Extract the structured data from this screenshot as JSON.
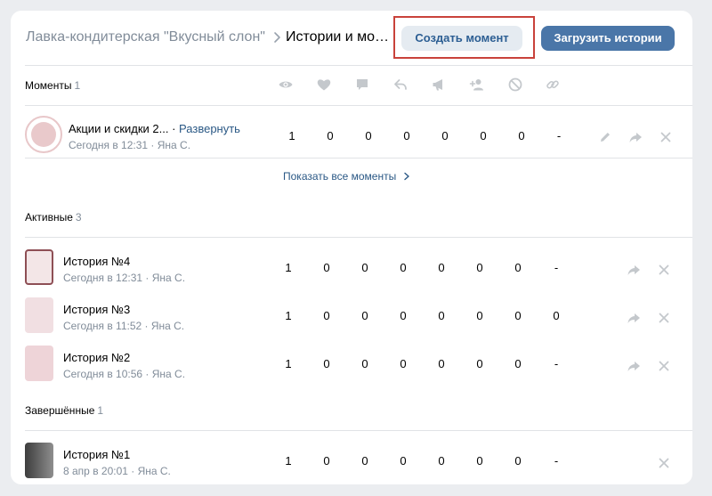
{
  "header": {
    "breadcrumb_parent": "Лавка-кондитерская \"Вкусный слон\"",
    "breadcrumb_current": "Истории и моменты",
    "create_moment_label": "Создать момент",
    "upload_stories_label": "Загрузить истории"
  },
  "columns": [
    "eye-icon",
    "heart-icon",
    "comment-icon",
    "reply-icon",
    "megaphone-icon",
    "add-user-icon",
    "block-icon",
    "link-icon"
  ],
  "moments": {
    "title": "Моменты",
    "count": "1",
    "items": [
      {
        "title": "Акции и скидки 2...",
        "expand": "Развернуть",
        "subtitle": "Сегодня в 12:31 · Яна С.",
        "values": [
          "1",
          "0",
          "0",
          "0",
          "0",
          "0",
          "0",
          "-"
        ]
      }
    ],
    "show_all": "Показать все моменты"
  },
  "active": {
    "title": "Активные",
    "count": "3",
    "items": [
      {
        "title": "История №4",
        "subtitle": "Сегодня в 12:31 · Яна С.",
        "values": [
          "1",
          "0",
          "0",
          "0",
          "0",
          "0",
          "0",
          "-"
        ]
      },
      {
        "title": "История №3",
        "subtitle": "Сегодня в 11:52 · Яна С.",
        "values": [
          "1",
          "0",
          "0",
          "0",
          "0",
          "0",
          "0",
          "0"
        ]
      },
      {
        "title": "История №2",
        "subtitle": "Сегодня в 10:56 · Яна С.",
        "values": [
          "1",
          "0",
          "0",
          "0",
          "0",
          "0",
          "0",
          "-"
        ]
      }
    ]
  },
  "finished": {
    "title": "Завершённые",
    "count": "1",
    "items": [
      {
        "title": "История №1",
        "subtitle": "8 апр в 20:01 · Яна С.",
        "values": [
          "1",
          "0",
          "0",
          "0",
          "0",
          "0",
          "0",
          "-"
        ]
      }
    ]
  },
  "colors": {
    "accent": "#4a76a8",
    "link": "#2a5885",
    "muted": "#818c99",
    "highlight_border": "#c9423b",
    "icon": "#c4c8cc"
  }
}
